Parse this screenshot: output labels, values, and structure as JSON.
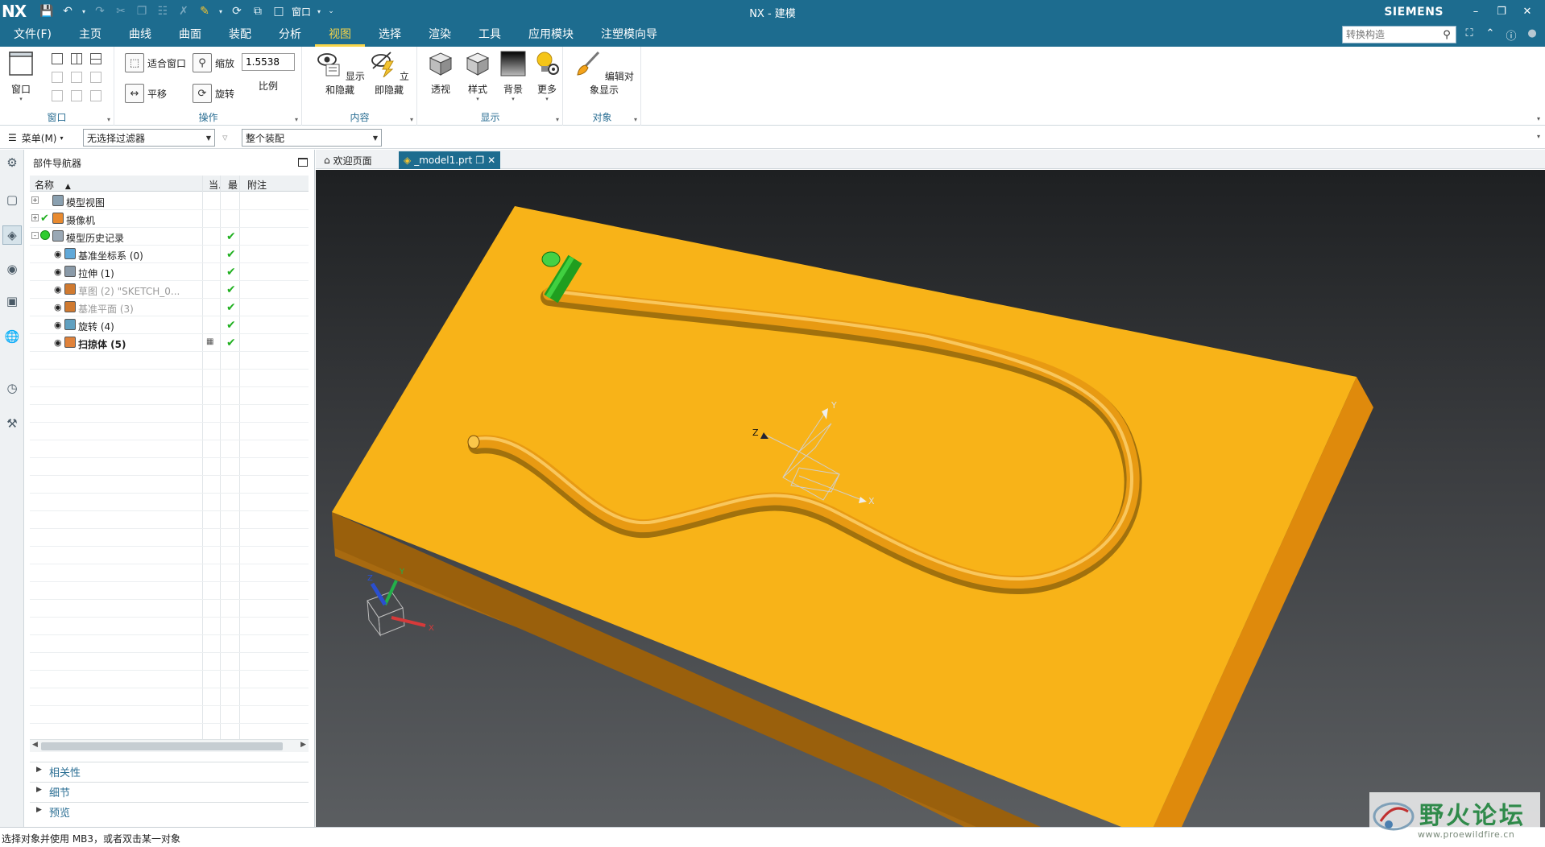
{
  "app": {
    "logo": "NX",
    "title": "NX - 建模",
    "brand": "SIEMENS",
    "qat_window_label": "窗口"
  },
  "menu": {
    "tabs": [
      "文件(F)",
      "主页",
      "曲线",
      "曲面",
      "装配",
      "分析",
      "视图",
      "选择",
      "渲染",
      "工具",
      "应用模块",
      "注塑模向导"
    ],
    "active_tab": "视图",
    "search_placeholder": "转换构造"
  },
  "ribbon": {
    "window_group": {
      "label": "窗口",
      "window_button": "窗口"
    },
    "operations_group": {
      "label": "操作",
      "fit": "适合窗口",
      "zoom": "缩放",
      "pan": "平移",
      "rotate": "旋转",
      "scale_value": "1.5538",
      "scale_label": "比例"
    },
    "content_group": {
      "label": "内容",
      "show_hide": "显示和隐藏",
      "instant_hide": "立即隐藏"
    },
    "display_group": {
      "label": "显示",
      "perspective": "透视",
      "style": "样式",
      "background": "背景",
      "more": "更多"
    },
    "object_group": {
      "label": "对象",
      "edit_display": "编辑对象显示"
    }
  },
  "toolbar2": {
    "menu_label": "菜单(M)",
    "filter_value": "无选择过滤器",
    "scope_value": "整个装配"
  },
  "navigator": {
    "title": "部件导航器",
    "columns": {
      "name": "名称",
      "current": "当.",
      "latest": "最",
      "note": "附注"
    },
    "rows": [
      {
        "label": "模型视图",
        "level": 0,
        "expander": "+",
        "checked": false,
        "eye": "",
        "current": false,
        "style": "normal"
      },
      {
        "label": "摄像机",
        "level": 0,
        "expander": "+",
        "checked": true,
        "eye": "",
        "current": false,
        "style": "normal"
      },
      {
        "label": "模型历史记录",
        "level": 0,
        "expander": "-",
        "checked": false,
        "eye": "",
        "current": true,
        "style": "normal"
      },
      {
        "label": "基准坐标系 (0)",
        "level": 1,
        "expander": "",
        "checked": false,
        "eye": "●",
        "current": true,
        "style": "normal"
      },
      {
        "label": "拉伸 (1)",
        "level": 1,
        "expander": "",
        "checked": false,
        "eye": "●",
        "current": true,
        "style": "normal"
      },
      {
        "label": "草图 (2) \"SKETCH_0...",
        "level": 1,
        "expander": "",
        "checked": false,
        "eye": "○",
        "current": true,
        "style": "dim"
      },
      {
        "label": "基准平面 (3)",
        "level": 1,
        "expander": "",
        "checked": false,
        "eye": "○",
        "current": true,
        "style": "dim"
      },
      {
        "label": "旋转 (4)",
        "level": 1,
        "expander": "",
        "checked": false,
        "eye": "●",
        "current": true,
        "style": "normal"
      },
      {
        "label": "扫掠体 (5)",
        "level": 1,
        "expander": "",
        "checked": false,
        "eye": "●",
        "current": true,
        "style": "bold"
      }
    ],
    "panels": [
      "相关性",
      "细节",
      "预览"
    ]
  },
  "doc_tabs": [
    {
      "label": "欢迎页面",
      "active": false
    },
    {
      "label": "_model1.prt",
      "active": true
    }
  ],
  "viewport": {
    "csys_labels": {
      "x": "X",
      "y": "Y",
      "z": "Z"
    },
    "colors": {
      "part": "#f8b318",
      "part_side": "#df8a0c",
      "part_front": "#a86a10",
      "groove": "#e89a12",
      "pin": "#22bb22"
    }
  },
  "status": {
    "prompt": "选择对象并使用 MB3，或者双击某一对象"
  },
  "watermark": {
    "title": "野火论坛",
    "url": "www.proewildfire.cn"
  }
}
